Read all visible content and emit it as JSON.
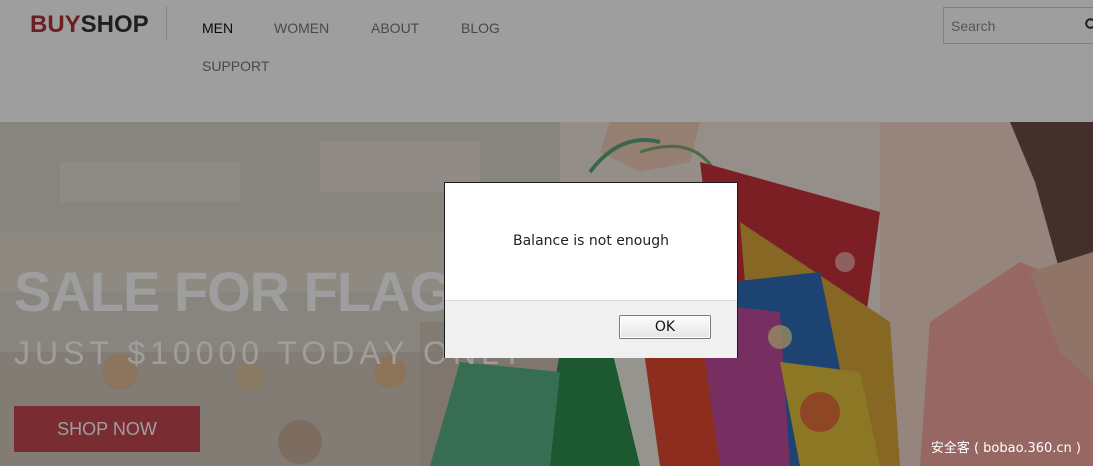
{
  "header": {
    "logo": {
      "part1": "BUY",
      "part2": "SHOP"
    },
    "nav": [
      {
        "label": "MEN",
        "active": true
      },
      {
        "label": "WOMEN",
        "active": false
      },
      {
        "label": "ABOUT",
        "active": false
      },
      {
        "label": "BLOG",
        "active": false
      },
      {
        "label": "SUPPORT",
        "active": false
      }
    ],
    "search": {
      "placeholder": "Search",
      "value": ""
    }
  },
  "hero": {
    "title": "SALE FOR FLAG.",
    "subtitle": "JUST $10000 TODAY ONLY",
    "button_label": "SHOP NOW"
  },
  "dialog": {
    "message": "Balance is not enough",
    "ok_label": "OK"
  },
  "watermark": "安全客 ( bobao.360.cn )",
  "colors": {
    "brand_red": "#b2333a",
    "button_red": "#c44750",
    "overlay": "rgba(0,0,0,0.38)"
  }
}
